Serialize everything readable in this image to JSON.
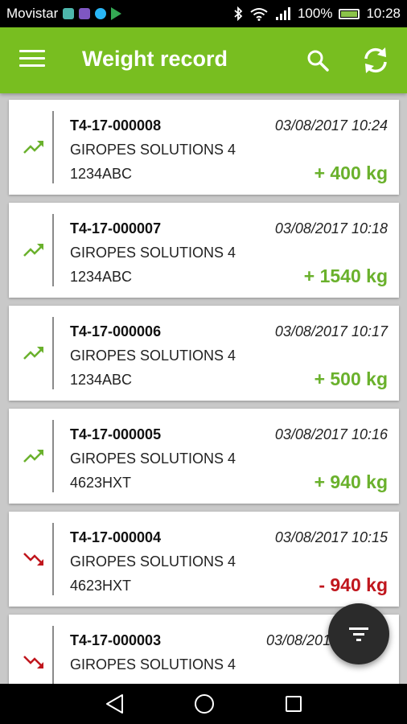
{
  "status_bar": {
    "carrier": "Movistar",
    "battery": "100%",
    "time": "10:28",
    "battery_level": 1.0,
    "app_icon_colors": [
      "#4db6ac",
      "#7e57c2",
      "#29b6f6",
      "#34a853"
    ]
  },
  "header": {
    "title": "Weight record",
    "menu_icon": "menu-icon",
    "search_icon": "search-icon",
    "refresh_icon": "refresh-icon"
  },
  "colors": {
    "primary": "#78be20",
    "positive": "#6ab12c",
    "negative": "#c0161d",
    "fab": "#2b2b2b"
  },
  "records": [
    {
      "code": "T4-17-000008",
      "date": "03/08/2017 10:24",
      "company": "GIROPES SOLUTIONS 4",
      "plate": "1234ABC",
      "weight": "+ 400 kg",
      "direction": "up"
    },
    {
      "code": "T4-17-000007",
      "date": "03/08/2017 10:18",
      "company": "GIROPES SOLUTIONS 4",
      "plate": "1234ABC",
      "weight": "+ 1540 kg",
      "direction": "up"
    },
    {
      "code": "T4-17-000006",
      "date": "03/08/2017 10:17",
      "company": "GIROPES SOLUTIONS 4",
      "plate": "1234ABC",
      "weight": "+ 500 kg",
      "direction": "up"
    },
    {
      "code": "T4-17-000005",
      "date": "03/08/2017 10:16",
      "company": "GIROPES SOLUTIONS 4",
      "plate": "4623HXT",
      "weight": "+ 940 kg",
      "direction": "up"
    },
    {
      "code": "T4-17-000004",
      "date": "03/08/2017 10:15",
      "company": "GIROPES SOLUTIONS 4",
      "plate": "4623HXT",
      "weight": "- 940 kg",
      "direction": "down"
    },
    {
      "code": "T4-17-000003",
      "date": "03/08/2017 10:",
      "company": "GIROPES SOLUTIONS 4",
      "plate": "",
      "weight": "",
      "direction": "down"
    }
  ],
  "fab": {
    "icon": "filter-icon"
  },
  "nav_bar": {
    "back_icon": "back-icon",
    "home_icon": "home-icon",
    "recents_icon": "recents-icon"
  }
}
